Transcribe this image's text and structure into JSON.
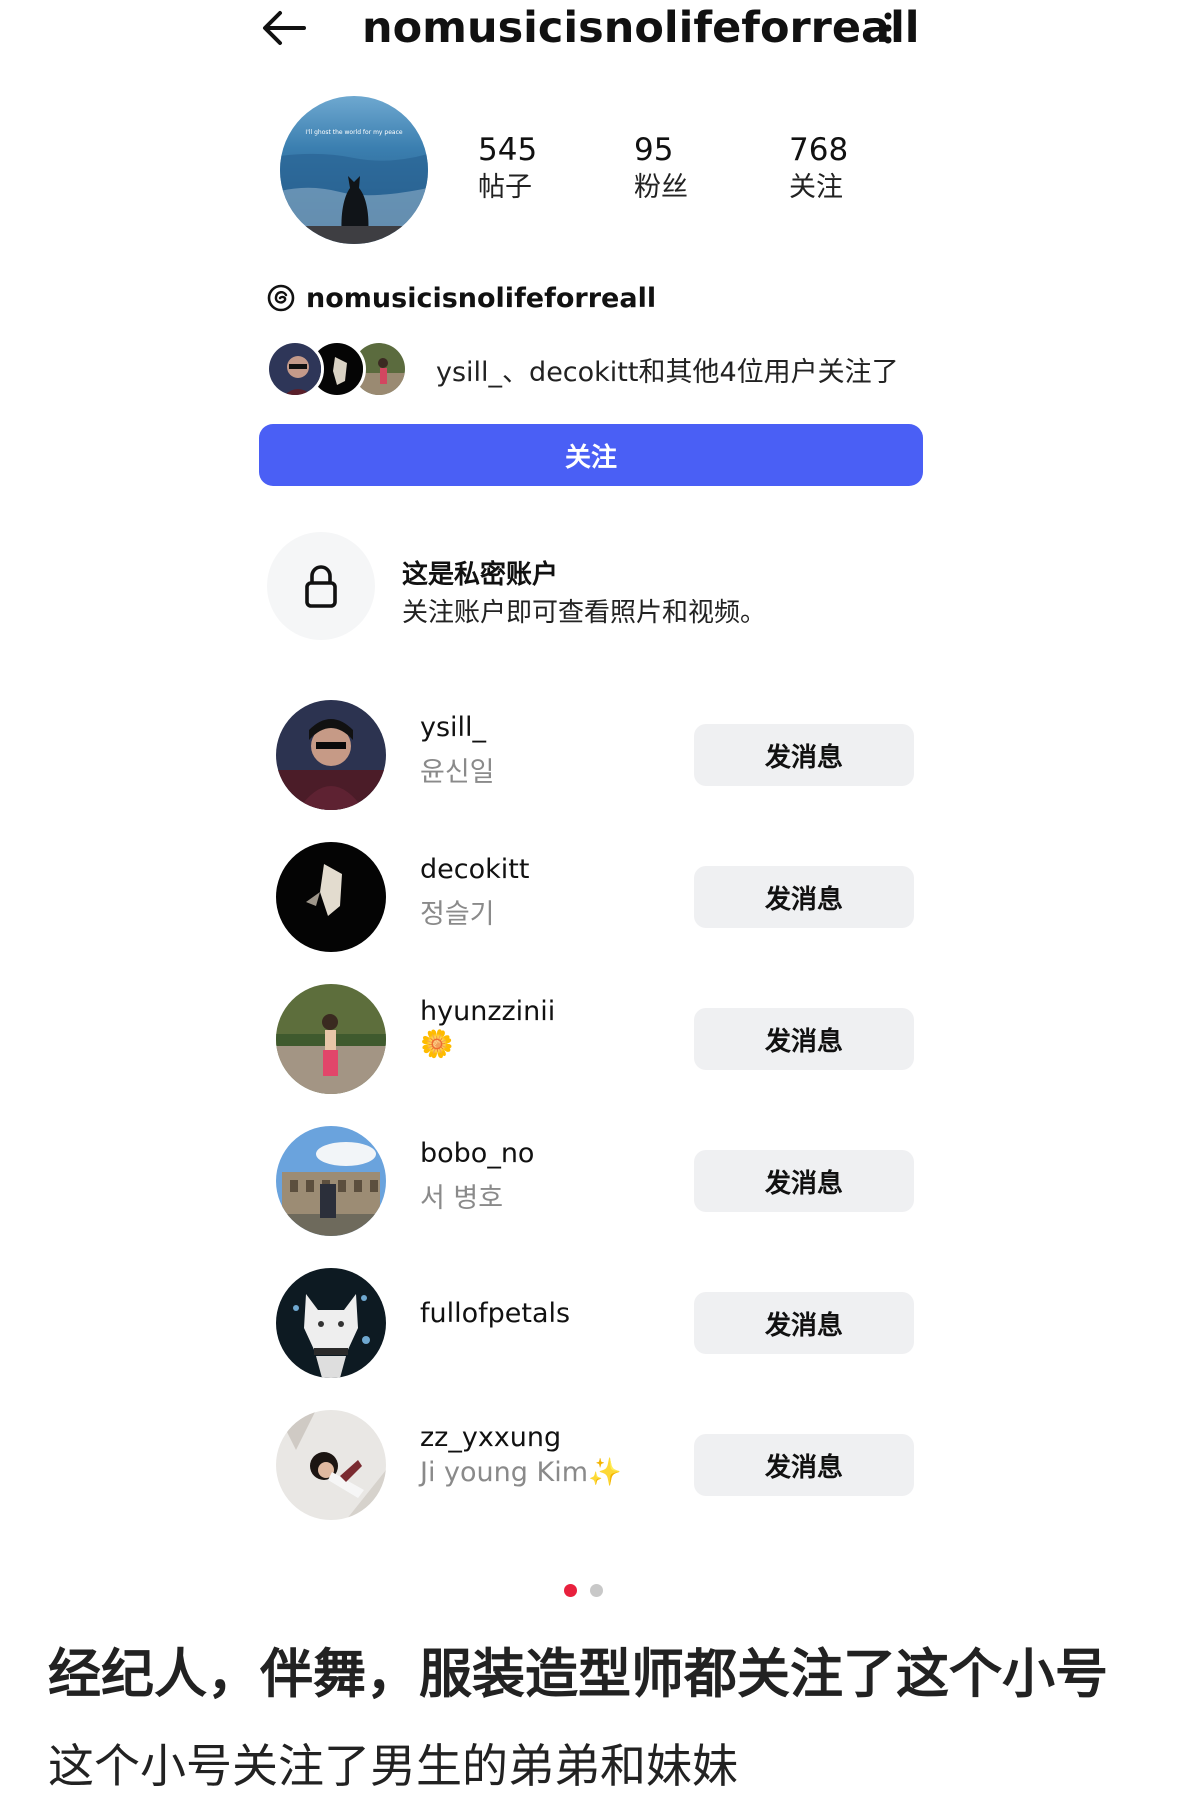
{
  "header": {
    "title": "nomusicisnolifeforreall",
    "back_icon": "arrow-left-icon",
    "more_icon": "more-vertical-icon"
  },
  "profile": {
    "avatar_text": "I'll ghost the world for my peace",
    "stats": [
      {
        "value": "545",
        "label": "帖子"
      },
      {
        "value": "95",
        "label": "粉丝"
      },
      {
        "value": "768",
        "label": "关注"
      }
    ],
    "threads_handle": "nomusicisnolifeforreall",
    "mutual_text": "ysill_、decokitt和其他4位用户关注了",
    "follow_label": "关注"
  },
  "private": {
    "title": "这是私密账户",
    "subtitle": "关注账户即可查看照片和视频。"
  },
  "followers": [
    {
      "username": "ysill_",
      "fullname": "윤신일",
      "button": "发消息"
    },
    {
      "username": "decokitt",
      "fullname": "정슬기",
      "button": "发消息"
    },
    {
      "username": "hyunzzinii",
      "fullname": "🌼",
      "button": "发消息"
    },
    {
      "username": "bobo_no",
      "fullname": "서 병호",
      "button": "发消息"
    },
    {
      "username": "fullofpetals",
      "fullname": "",
      "button": "发消息"
    },
    {
      "username": "zz_yxxung",
      "fullname": "Ji young Kim✨",
      "button": "发消息"
    }
  ],
  "pager": {
    "active_color": "#e8203d",
    "inactive_color": "#c8c8c8"
  },
  "caption": {
    "line1": "经纪人，伴舞，服装造型师都关注了这个小号",
    "line2": "这个小号关注了男生的弟弟和妹妹"
  },
  "colors": {
    "accent": "#4a5ff5",
    "button_gray": "#eff0f2"
  }
}
